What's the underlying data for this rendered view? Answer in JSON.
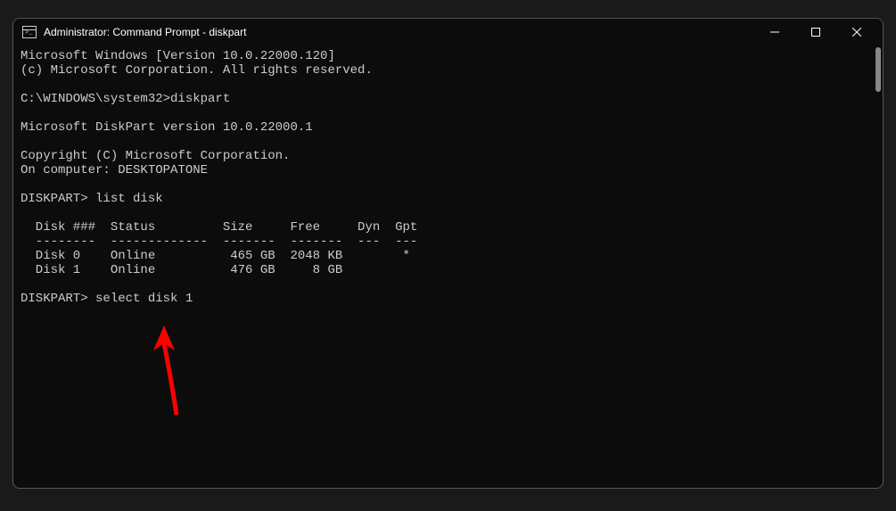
{
  "window": {
    "title": "Administrator: Command Prompt - diskpart"
  },
  "terminal": {
    "line1": "Microsoft Windows [Version 10.0.22000.120]",
    "line2": "(c) Microsoft Corporation. All rights reserved.",
    "blank1": "",
    "prompt1": "C:\\WINDOWS\\system32>diskpart",
    "blank2": "",
    "version": "Microsoft DiskPart version 10.0.22000.1",
    "blank3": "",
    "copyright": "Copyright (C) Microsoft Corporation.",
    "computer": "On computer: DESKTOPATONE",
    "blank4": "",
    "prompt2": "DISKPART> list disk",
    "blank5": "",
    "table_header": "  Disk ###  Status         Size     Free     Dyn  Gpt",
    "table_divider": "  --------  -------------  -------  -------  ---  ---",
    "table_row0": "  Disk 0    Online          465 GB  2048 KB        *",
    "table_row1": "  Disk 1    Online          476 GB     8 GB",
    "blank6": "",
    "prompt3": "DISKPART> select disk 1"
  }
}
